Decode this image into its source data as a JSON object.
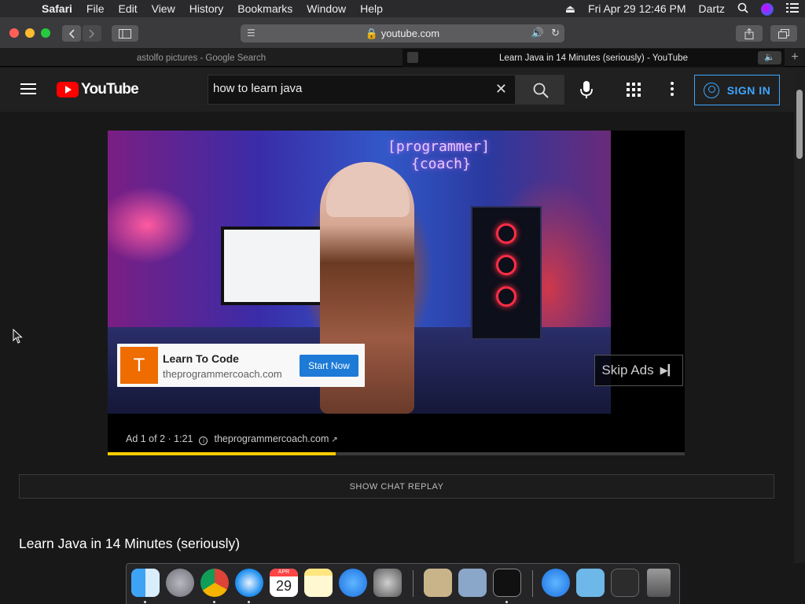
{
  "menubar": {
    "apple": "",
    "items": [
      "Safari",
      "File",
      "Edit",
      "View",
      "History",
      "Bookmarks",
      "Window",
      "Help"
    ],
    "datetime": "Fri Apr 29  12:46 PM",
    "user": "Dartz"
  },
  "toolbar": {
    "url": "youtube.com"
  },
  "tabs": [
    {
      "title": "astolfo pictures - Google Search",
      "active": false
    },
    {
      "title": "Learn Java in 14 Minutes (seriously) - YouTube",
      "active": true
    }
  ],
  "youtube": {
    "logo_text": "YouTube",
    "search_value": "how to learn java",
    "sign_in": "SIGN IN"
  },
  "player": {
    "sign_text_line1": "[programmer]",
    "sign_text_line2": "{coach}",
    "ad_card": {
      "letter": "T",
      "title": "Learn To Code",
      "domain": "theprogrammercoach.com",
      "cta": "Start Now"
    },
    "skip": "Skip Ads",
    "ad_info": "Ad 1 of 2 · 1:21",
    "ad_domain": "theprogrammercoach.com",
    "progress_fraction": 0.395
  },
  "page": {
    "show_chat_replay": "SHOW CHAT REPLAY",
    "video_title": "Learn Java in 14 Minutes (seriously)"
  },
  "dock": {
    "calendar_month": "APR",
    "calendar_day": "29"
  },
  "colors": {
    "youtube_red": "#ff0000",
    "signin_blue": "#3ea6ff",
    "progress_yellow": "#ffcc00",
    "ad_orange": "#ee6c00",
    "cta_blue": "#1d7ad6"
  }
}
